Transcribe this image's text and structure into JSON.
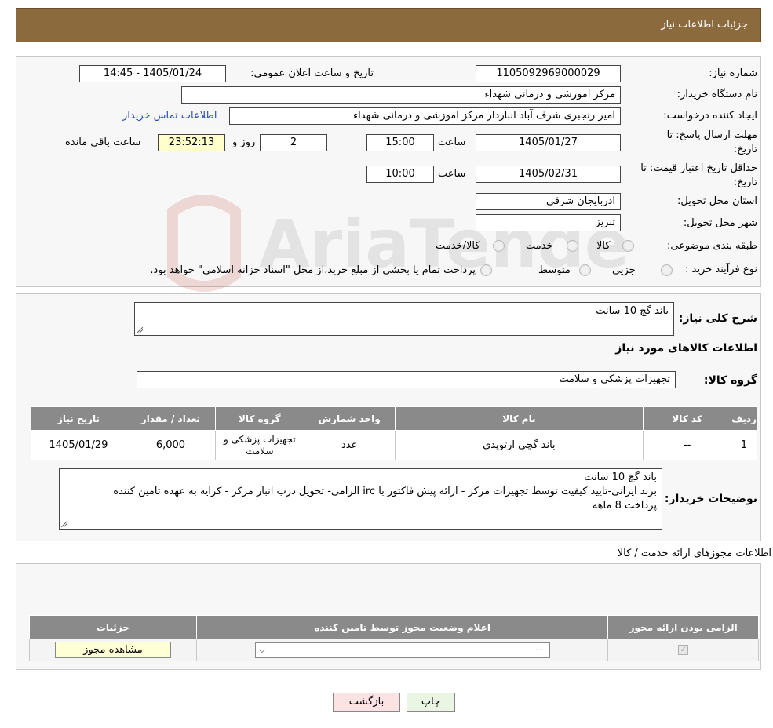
{
  "header": {
    "title": "جزئیات اطلاعات نیاز"
  },
  "watermark": {
    "text": "AriaTender.neT"
  },
  "form": {
    "need_number_label": "شماره نیاز:",
    "need_number": "1105092969000029",
    "announce_label": "تاریخ و ساعت اعلان عمومی:",
    "announce_value": "1405/01/24 - 14:45",
    "buyer_org_label": "نام دستگاه خریدار:",
    "buyer_org": "مرکز اموزشی و درمانی شهداء",
    "creator_label": "ایجاد کننده درخواست:",
    "creator": "امیر رنجبری شرف آباد انباردار مرکز اموزشی و درمانی شهداء",
    "contact_link": "اطلاعات تماس خریدار",
    "deadline_label_1": "مهلت ارسال پاسخ: تا",
    "deadline_label_2": "تاریخ:",
    "deadline_date": "1405/01/27",
    "time_label": "ساعت",
    "deadline_time": "15:00",
    "days_value": "2",
    "days_label": "روز و",
    "remaining_time": "23:52:13",
    "remaining_label": "ساعت باقی مانده",
    "validity_label_1": "حداقل تاریخ اعتبار قیمت: تا",
    "validity_label_2": "تاریخ:",
    "validity_date": "1405/02/31",
    "validity_time": "10:00",
    "province_label": "استان محل تحویل:",
    "province": "آذربایجان شرقی",
    "city_label": "شهر محل تحویل:",
    "city": "تبریز",
    "category_label": "طبقه بندی موضوعی:",
    "category_options": [
      "کالا",
      "خدمت",
      "کالا/خدمت"
    ],
    "process_label": "نوع فرآیند خرید :",
    "process_options": [
      "جزیی",
      "متوسط"
    ],
    "process_note": "پرداخت تمام یا بخشی از مبلغ خرید،از محل \"اسناد خزانه اسلامی\" خواهد بود."
  },
  "summary": {
    "general_desc_label": "شرح کلی نیاز:",
    "general_desc": "باند گچ 10 سانت",
    "goods_info_title": "اطلاعات کالاهای مورد نیاز",
    "goods_group_label": "گروه کالا:",
    "goods_group": "تجهیزات پزشکی و سلامت",
    "table": {
      "headers": [
        "ردیف",
        "کد کالا",
        "نام کالا",
        "واحد شمارش",
        "گروه کالا",
        "تعداد / مقدار",
        "تاریخ نیاز"
      ],
      "rows": [
        [
          "1",
          "--",
          "باند گچی ارتوپدی",
          "عدد",
          "تجهیزات پزشکی و سلامت",
          "6,000",
          "1405/01/29"
        ]
      ]
    },
    "buyer_notes_label": "توضیحات خریدار:",
    "buyer_notes": [
      "باند گچ 10 سانت",
      "برند ایرانی-تایید کیفیت توسط تجهیزات مرکز - ارائه پیش فاکتور با irc الزامی- تحویل درب انبار مرکز - کرایه به عهده تامین کننده",
      "پرداخت 8 ماهه"
    ]
  },
  "permits": {
    "title": "اطلاعات مجوزهای ارائه خدمت / کالا",
    "headers": [
      "الزامی بودن ارائه مجوز",
      "اعلام وضعیت مجوز توسط تامین کننده",
      "جزئیات"
    ],
    "select_value": "--",
    "view_button": "مشاهده مجوز"
  },
  "footer": {
    "print_button": "چاپ",
    "back_button": "بازگشت"
  },
  "colors": {
    "header_bg": "#8b6a3e",
    "table_header_bg": "#8a8a8a",
    "link": "#2a4fb8",
    "highlight": "#ffffcc"
  }
}
